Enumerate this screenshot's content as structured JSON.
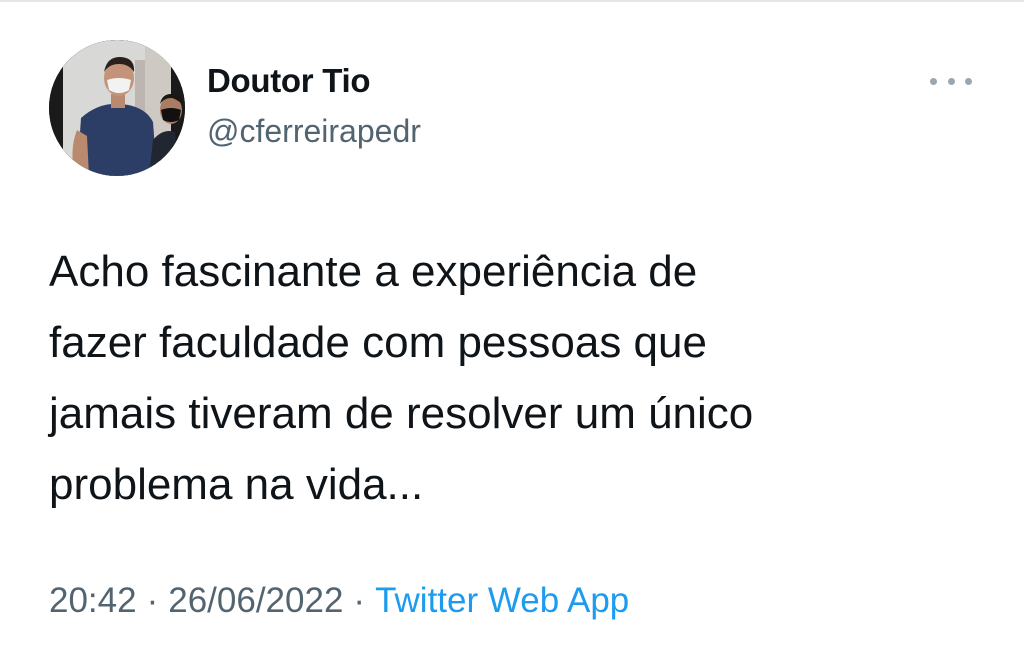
{
  "tweet": {
    "author": {
      "display_name": "Doutor Tio",
      "handle": "@cferreirapedr",
      "avatar_icon": "profile-photo"
    },
    "more_icon": "more-options-icon",
    "text_lines": [
      "Acho fascinante a experiência de",
      "fazer faculdade com pessoas que",
      "jamais tiveram de resolver um único",
      "problema na vida..."
    ],
    "time": "20:42",
    "separator": "·",
    "date": "26/06/2022",
    "source": "Twitter Web App"
  },
  "colors": {
    "text": "#0f1419",
    "secondary": "#536471",
    "link": "#1d9bf0"
  }
}
